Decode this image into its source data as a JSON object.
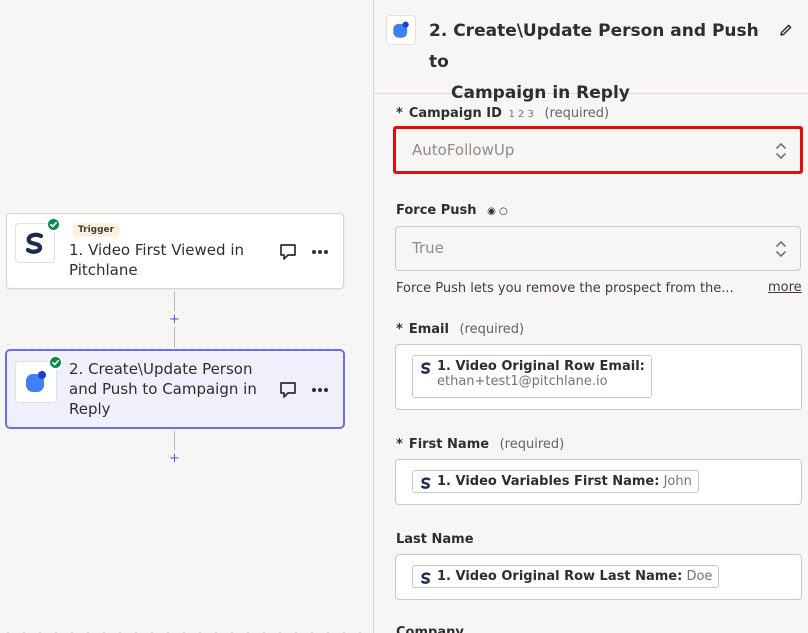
{
  "flow": {
    "steps": [
      {
        "badge": "Trigger",
        "title": "1. Video First Viewed in Pitchlane"
      },
      {
        "title": "2. Create\\Update Person and Push to Campaign in Reply"
      }
    ],
    "add_step_symbol": "+"
  },
  "panel": {
    "title_line1": "2. Create\\Update Person and Push to",
    "title_line2": "Campaign in Reply",
    "fields": {
      "campaign_id": {
        "required_mark": "*",
        "label": "Campaign ID",
        "hint": "1 2 3",
        "required_text": "(required)",
        "value": "AutoFollowUp"
      },
      "force_push": {
        "label": "Force Push",
        "radio_icons": "◉ ○",
        "value": "True",
        "help": "Force Push lets you remove the prospect from the...",
        "more_link": "more"
      },
      "email": {
        "required_mark": "*",
        "label": "Email",
        "required_text": "(required)",
        "pill_label": "1. Video Original Row Email:",
        "pill_value": "ethan+test1@pitchlane.io"
      },
      "first_name": {
        "required_mark": "*",
        "label": "First Name",
        "required_text": "(required)",
        "pill_label": "1. Video Variables First Name:",
        "pill_value": "John"
      },
      "last_name": {
        "label": "Last Name",
        "pill_label": "1. Video Original Row Last Name:",
        "pill_value": "Doe"
      },
      "company": {
        "label": "Company"
      }
    }
  },
  "colors": {
    "accent": "#5d5ae0",
    "selected_border": "#6c6ee2",
    "success": "#0b8a4a",
    "highlight": "#e10c0c",
    "reply_blue": "#3f80f5"
  }
}
